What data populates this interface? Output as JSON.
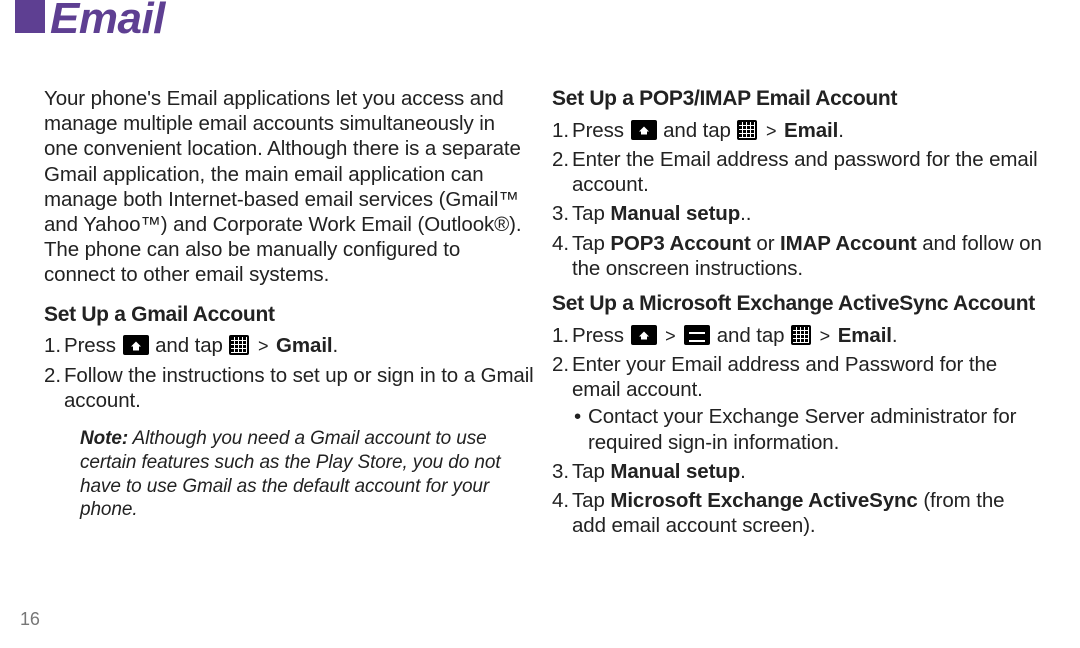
{
  "title": "Email",
  "pageNumber": "16",
  "left": {
    "intro": "Your phone's Email applications let you access and manage multiple email accounts simultaneously in one convenient location. Although there is a separate Gmail application, the main email application can manage both Internet-based email services (Gmail™ and Yahoo™) and Corporate Work Email (Outlook®). The phone can also be manually configured to connect to other email systems.",
    "h_gmail": "Set Up a Gmail Account",
    "gmail_step1_a": "Press ",
    "gmail_step1_b": " and tap ",
    "gmail_step1_gt": ">",
    "gmail_step1_c": " Gmail",
    "gmail_step1_dot": ".",
    "gmail_step2": "Follow the instructions to set up or sign in to a Gmail account.",
    "note_label": "Note:",
    "note_body": " Although you need a Gmail account to use certain features such as the Play Store, you do not have to use Gmail as the default account for your phone."
  },
  "right": {
    "h_pop": "Set Up a POP3/IMAP Email Account",
    "pop_step1_a": "Press ",
    "pop_step1_b": " and tap ",
    "pop_gt": ">",
    "pop_step1_c": " Email",
    "pop_step1_dot": ".",
    "pop_step2": "Enter the Email address and password for the email account.",
    "pop_step3_a": "Tap ",
    "pop_step3_b": "Manual setup",
    "pop_step3_dot": "..",
    "pop_step4_a": "Tap ",
    "pop_step4_b": "POP3 Account",
    "pop_step4_c": " or ",
    "pop_step4_d": "IMAP Account",
    "pop_step4_e": " and follow on the onscreen instructions.",
    "h_ex": "Set Up a Microsoft Exchange ActiveSync Account",
    "ex_step1_a": "Press ",
    "ex_gt1": ">",
    "ex_step1_b": " and tap ",
    "ex_gt2": ">",
    "ex_step1_c": " Email",
    "ex_step1_dot": ".",
    "ex_step2": "Enter your Email address and Password for the email account.",
    "ex_step2_bullet": "Contact your Exchange Server administrator for required sign-in information.",
    "ex_step3_a": "Tap ",
    "ex_step3_b": "Manual setup",
    "ex_step3_dot": ".",
    "ex_step4_a": "Tap ",
    "ex_step4_b": "Microsoft Exchange ActiveSync",
    "ex_step4_c": " (from the add email account screen)."
  }
}
